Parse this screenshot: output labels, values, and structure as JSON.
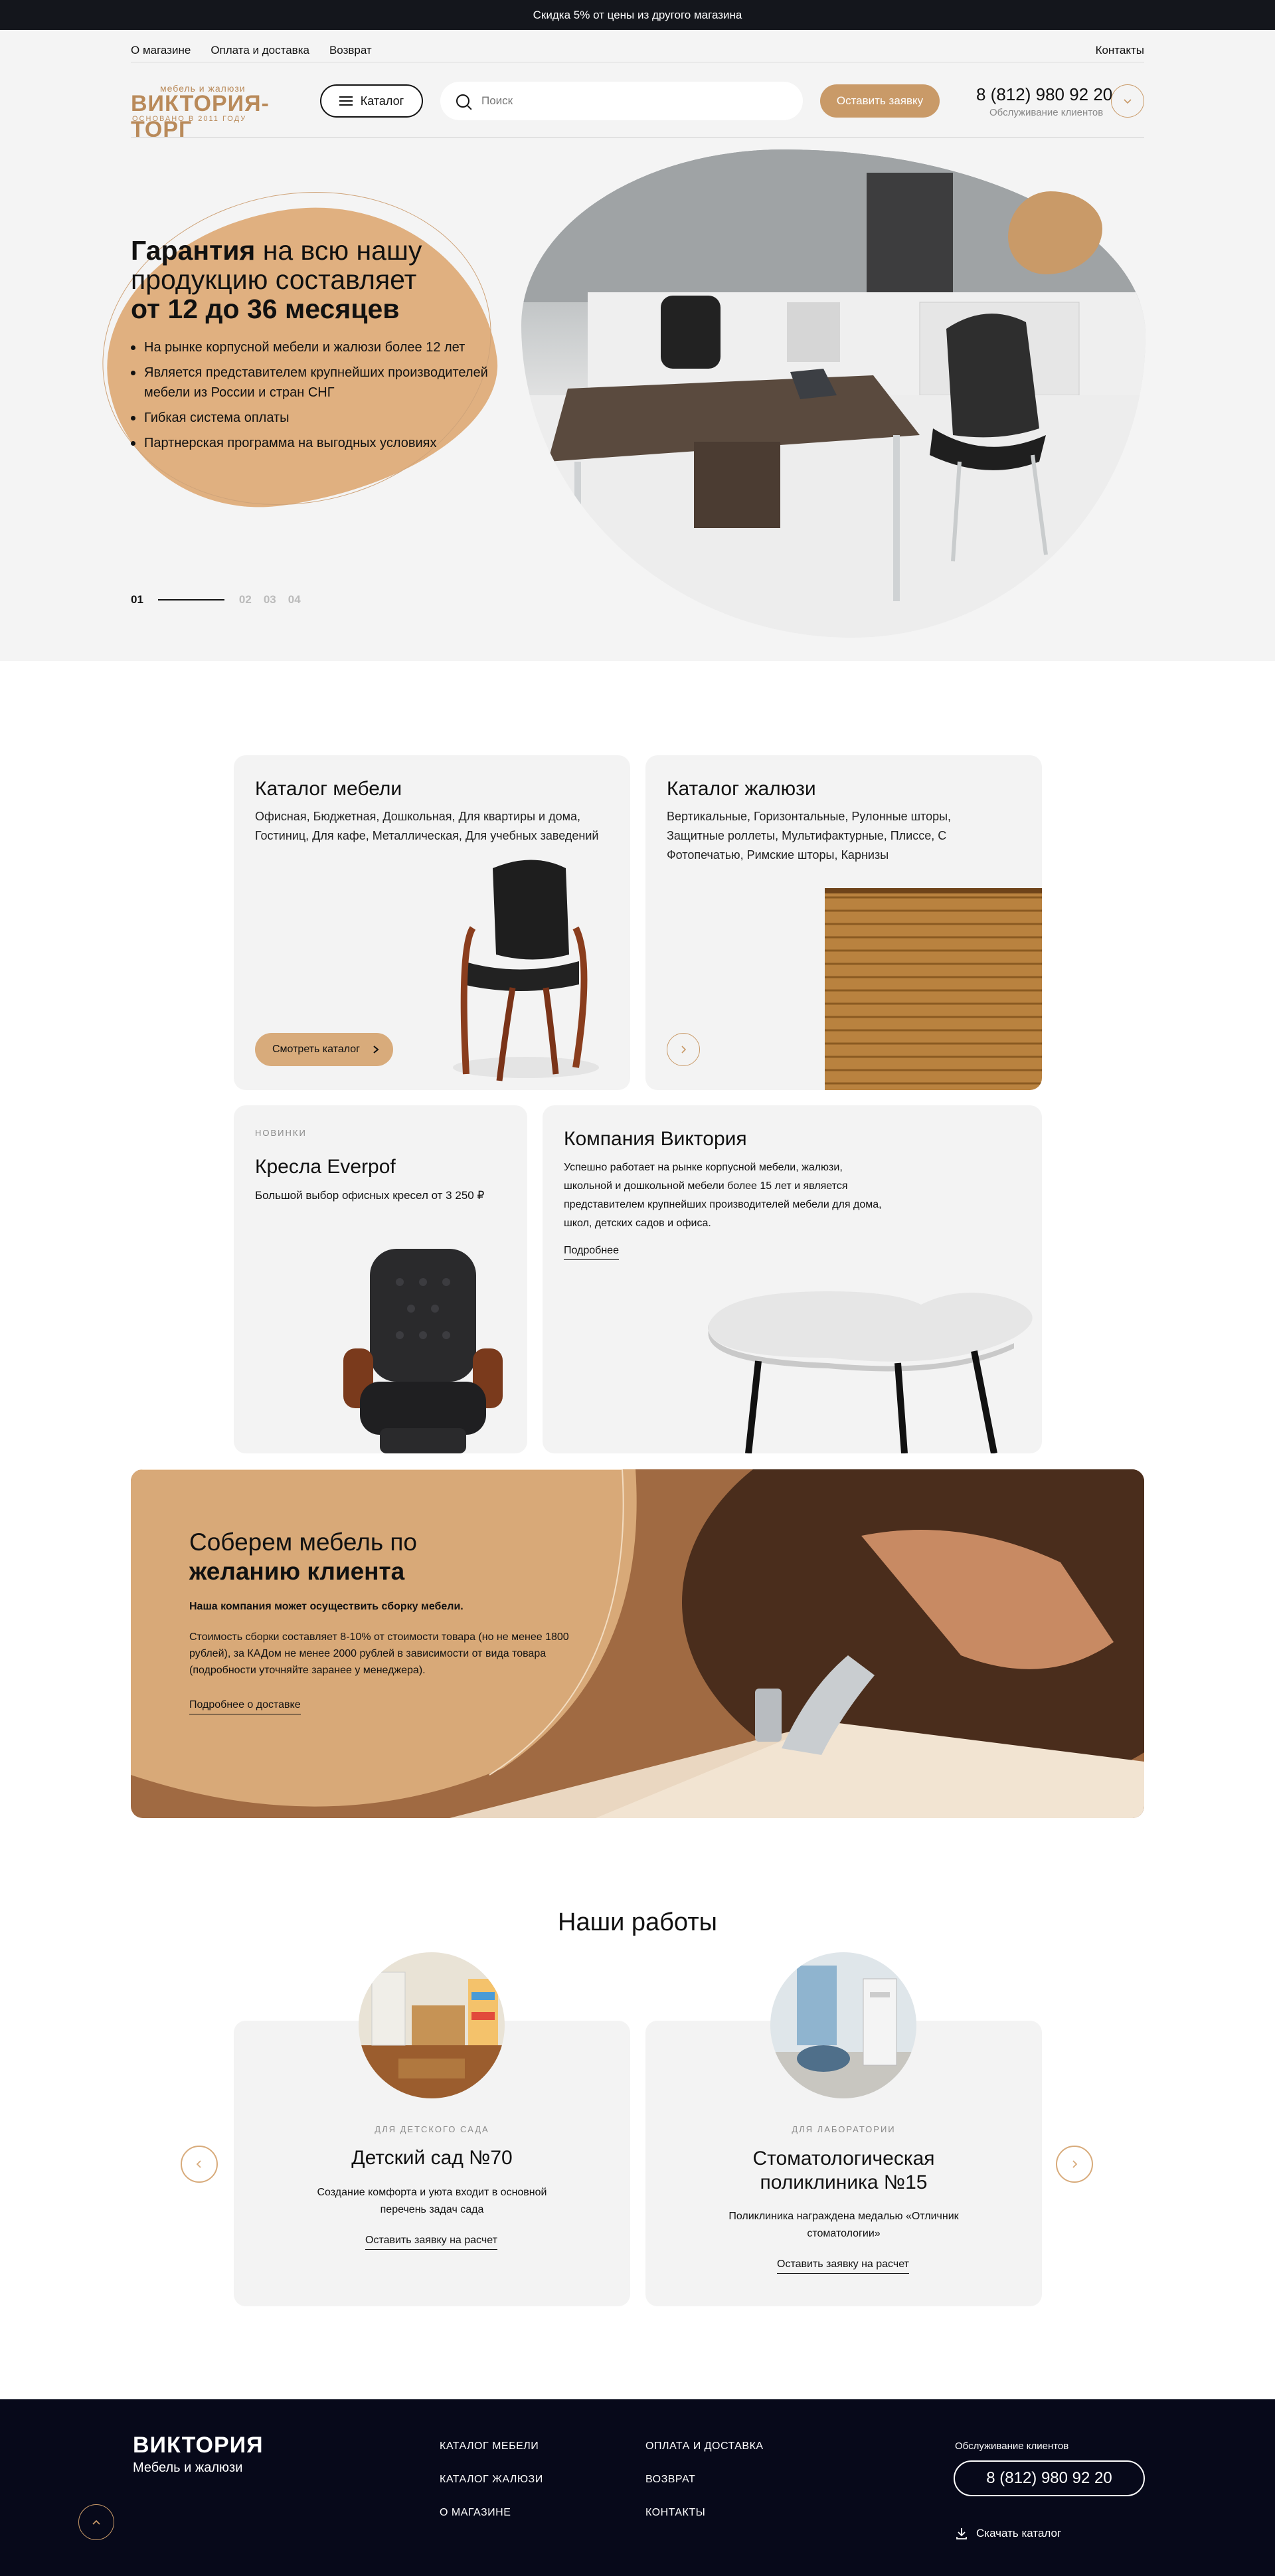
{
  "topbar": {
    "text": "Скидка 5% от цены из другого магазина"
  },
  "subnav": {
    "items": [
      "О магазине",
      "Оплата и доставка",
      "Возврат"
    ],
    "contacts": "Контакты"
  },
  "header": {
    "logo_small": "мебель и жалюзи",
    "logo_big": "ВИКТОРИЯ-ТОРГ",
    "logo_since": "ОСНОВАНО В 2011 ГОДУ",
    "catalog_label": "Каталог",
    "search_placeholder": "Поиск",
    "request_label": "Оставить заявку",
    "phone": "8 (812) 980 92 20",
    "phone_sub": "Обслуживание клиентов"
  },
  "hero": {
    "title_bold1": "Гарантия",
    "title_rest1": " на всю нашу",
    "title_line2": "продукцию составляет",
    "title_bold3": "от 12 до 36 месяцев",
    "bullets": [
      "На рынке корпусной мебели и жалюзи более 12 лет",
      "Является представителем крупнейших производителей мебели из России и стран СНГ",
      "Гибкая система оплаты",
      "Партнерская программа на выгодных условиях"
    ],
    "slides": [
      "01",
      "02",
      "03",
      "04"
    ],
    "active_slide": "01"
  },
  "cards": {
    "furniture": {
      "title": "Каталог мебели",
      "text": "Офисная, Бюджетная, Дошкольная, Для квартиры и дома, Гостиниц, Для кафе, Металлическая, Для учебных заведений",
      "button": "Смотреть каталог"
    },
    "blinds": {
      "title": "Каталог  жалюзи",
      "text": "Вертикальные, Горизонтальные, Рулонные шторы, Защитные роллеты, Мультифактурные, Плиссе, С Фотопечатью, Римские шторы, Карнизы"
    },
    "chairs": {
      "label": "НОВИНКИ",
      "title": "Кресла Everpof",
      "text": "Большой выбор офисных кресел от 3 250 ₽"
    },
    "company": {
      "title": "Компания Виктория",
      "text": "Успешно работает на рынке корпусной мебели, жалюзи, школьной и дошкольной мебели более 15 лет и является представителем крупнейших производителей мебели для дома, школ, детских садов и офиса.",
      "link": "Подробнее"
    }
  },
  "assembly": {
    "title_line1": "Соберем мебель по",
    "title_line2": "желанию клиента",
    "lead": "Наша компания может осуществить сборку мебели.",
    "text": "Стоимость сборки составляет 8-10% от стоимости товара (но не менее 1800 рублей), за КАДом не менее 2000 рублей в зависимости от вида товара (подробности уточняйте заранее у менеджера).",
    "link": "Подробнее о доставке"
  },
  "works": {
    "title": "Наши работы",
    "items": [
      {
        "label": "ДЛЯ ДЕТСКОГО САДА",
        "title": "Детский сад №70",
        "text": "Создание комфорта и уюта входит в основной перечень задач сада",
        "link": "Оставить заявку на расчет"
      },
      {
        "label": "ДЛЯ ЛАБОРАТОРИИ",
        "title": "Стоматологическая поликлиника №15",
        "text": "Поликлиника награждена медалью «Отличник стоматологии»",
        "link": "Оставить заявку на расчет"
      }
    ]
  },
  "footer": {
    "brand": "ВИКТОРИЯ",
    "brand_sub": "Мебель и жалюзи",
    "col1": [
      "КАТАЛОГ МЕБЕЛИ",
      "КАТАЛОГ ЖАЛЮЗИ",
      "О МАГАЗИНЕ"
    ],
    "col2": [
      "ОПЛАТА И ДОСТАВКА",
      "ВОЗВРАТ",
      "КОНТАКТЫ"
    ],
    "service_label": "Обслуживание клиентов",
    "phone": "8 (812) 980 92 20",
    "download": "Скачать каталог"
  },
  "colors": {
    "accent": "#c99a68",
    "accent_light": "#e0b080",
    "dark": "#07091a"
  }
}
